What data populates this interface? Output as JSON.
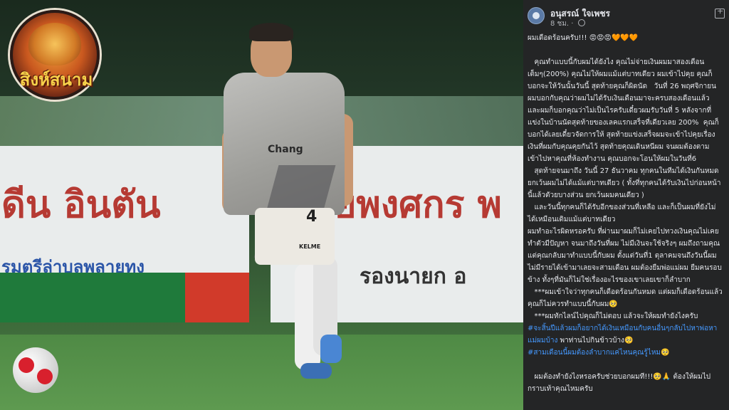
{
  "photo": {
    "logo_text": "สิงห์สนาม",
    "banner_left_line1": "ดีน อินตัน",
    "banner_left_line2": "รมตรีล่าบลพลายทง",
    "banner_right_line1": "ยพงศกร พ",
    "banner_right_line2": "รองนายก อ",
    "shirt_sponsor": "Chang",
    "shirt_number": "4",
    "shorts_brand": "KELME"
  },
  "post": {
    "author": "อนุสรณ์ ใจเพชร",
    "time": "8 ชม.",
    "separator": "·",
    "paragraphs": [
      "ผมเดือดร้อนครับ!!! 😡😡😡🧡🧡🧡",
      "",
      "   คุณทำแบบนี้กับผมได้ยังไง คุณไม่จ่ายเงินผมมาสองเดือนเต็มๆ(200%) คุณไม่ให้ผมแม้แต่บาทเดียว ผมเข้าไปคุย คุณก็บอกจะให้วันนั้นวันนี้ สุดท้ายคุณก็ผิดนัด   วันที่ 26 พฤศจิกายน ผมบอกกับคุณว่าผมไม่ได้รับเงินเดือนมาจะครบสองเดือนแล้ว และผมก็บอกคุณว่าไม่เป็นไรครับเดี๋ยวผมรับวันที่ 5 หลังจากที่แข่งในบ้านนัดสุดท้ายของเลคแรกเสร็จที่เดียวเลย 200%  คุณก็บอกได้เลยเดี๋ยวจัดการให้ สุดท้ายแข่งเสร็จผมจะเข้าไปคุยเรื่องเงินที่ผมกับคุณคุยกันไว้ สุดท้ายคุณเดินหนีผม จนผมต้องตามเข้าไปหาคุณที่ห้องทำงาน คุณบอกจะโอนให้ผมในวันที่6",
      "   สุดท้ายจนมาถึง วันนี้ 27 ธันวาคม ทุกคนในทีมได้เงินกันหมด ยกเว้นผมไม่ได้แม้แต่บาทเดียว ( ทั้งที่ทุกคนได้รับเงินไปก่อนหน้านี้แล้วตัวยบางส่วน ยกเว้นผมคนเดียว )",
      "   และวันนี้ทุกคนก็ได้รับอีกของส่วนที่เหลือ และก็เป็นผมที่ยังไม่ได้เหมือนเดิมแม้แต่บาทเดียว",
      "ผมทำอะไรผิดหรอครับ ที่ผ่านมาผมก็ไม่เคยไปทวงเงินคุณไม่เคยทำตัวมีปัญหา จนมาถึงวันที่ผม ไม่มีเงินจะใช้จริงๆ ผมถึงถามคุณ แต่คุณกลับมาทำแบบนี้กับผม ตั้งแต่วันที่1 ตุลาคมจนถึงวันนี้ผมไม่มีรายได้เข้ามาเลยจะสามเดือน ผมต้องยืมพ่อแม่ผม ยืมคนรอบข้าง ทั้งๆที่มันก็ไม่ใช่เรื่องอะไรของเขาเลยเขาก็ลำบาก",
      "   ***ผมเข้าใจว่าทุกคนก็เดือดร้อนกันหมด แต่ผมก็เดือดร้อนแล้วคุณก็ไม่ควรทำแบบนี้กับผม🥺",
      "   ***ผมทักไลน์ไปคุณก็ไม่ตอบ แล้วจะให้ผมทำยังไงครับ"
    ],
    "hashtag1": "#จะสิ้นปีแล้วผมก็อยากได้เงินเหมือนกับคนอื่นๆกลับไปหาพ่อหาแม่ผมบ้าง",
    "hashtag1_tail": " พาท่านไปกินข้าวบ้าง🥺",
    "hashtag2": "#สามเดือนนี้ผมต้องลำบากแค่ไหนคุณรู้ไหม",
    "hashtag2_tail": "🥺",
    "closing": "   ผมต้องทำยังไงหรอครับช่วยบอกผมที!!!🥺🙏 ต้องให้ผมไปกราบเท้าคุณไหมครับ"
  }
}
